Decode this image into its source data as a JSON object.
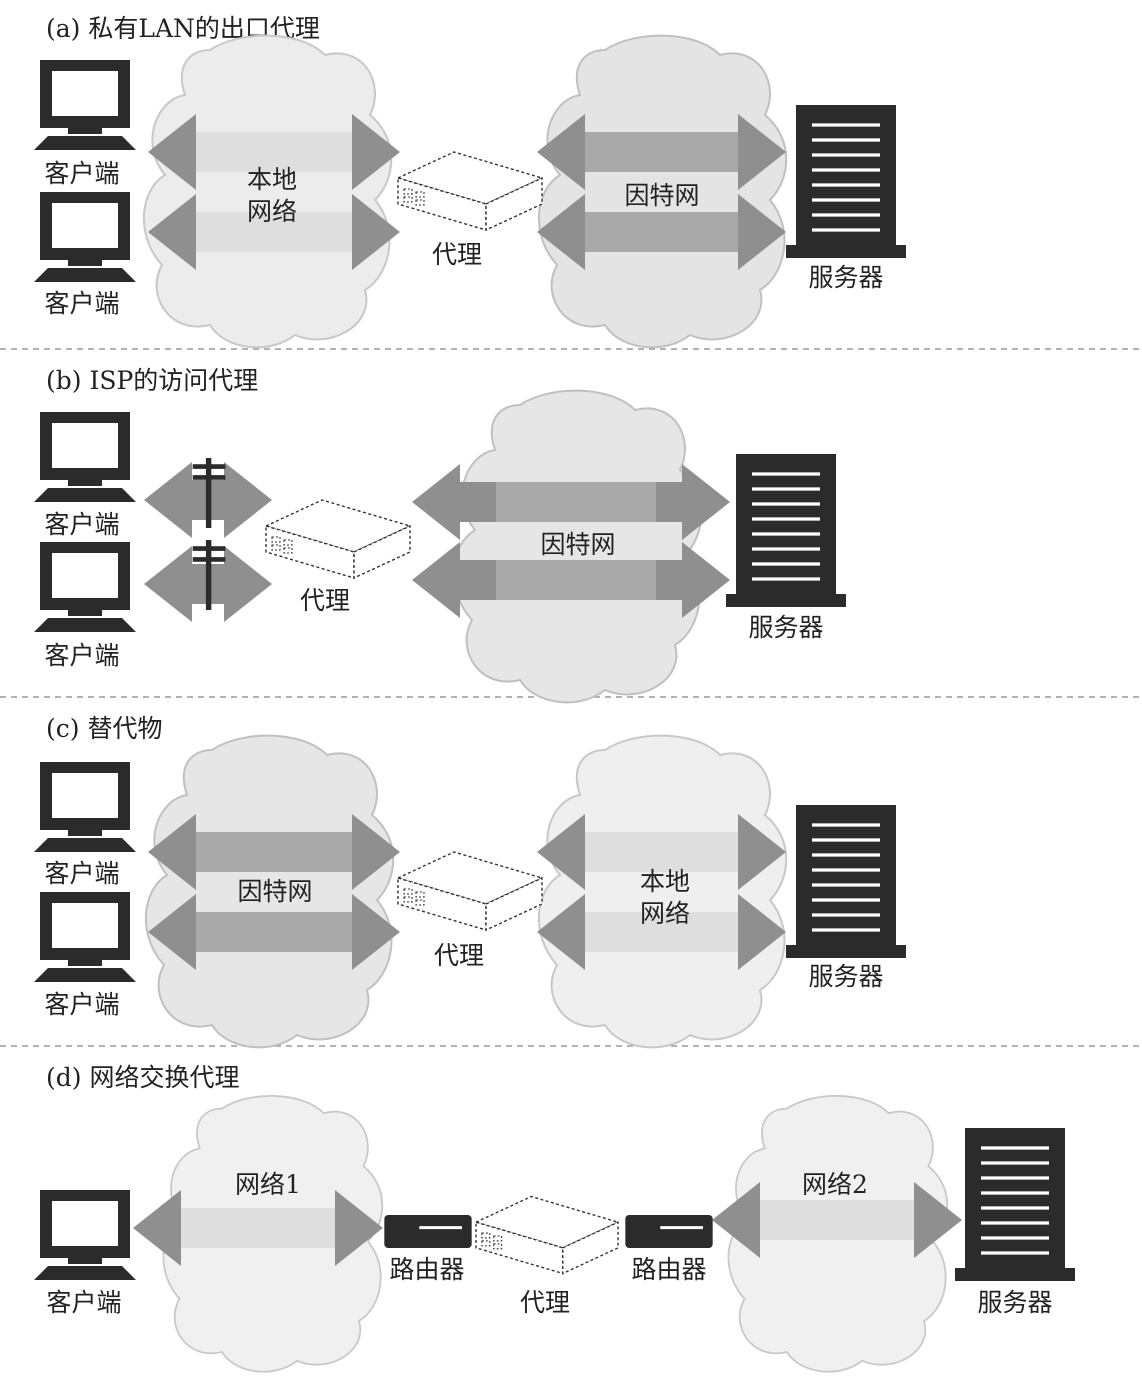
{
  "panels": [
    {
      "title": "(a) 私有LAN的出口代理",
      "client_label": "客户端",
      "client2_label": "客户端",
      "left_cloud_label": [
        "本地",
        "网络"
      ],
      "proxy_label": "代理",
      "right_cloud_label": [
        "因特网"
      ],
      "server_label": "服务器"
    },
    {
      "title": "(b) ISP的访问代理",
      "client_label": "客户端",
      "client2_label": "客户端",
      "proxy_label": "代理",
      "right_cloud_label": [
        "因特网"
      ],
      "server_label": "服务器"
    },
    {
      "title": "(c) 替代物",
      "client_label": "客户端",
      "client2_label": "客户端",
      "left_cloud_label": [
        "因特网"
      ],
      "proxy_label": "代理",
      "right_cloud_label": [
        "本地",
        "网络"
      ],
      "server_label": "服务器"
    },
    {
      "title": "(d) 网络交换代理",
      "client_label": "客户端",
      "left_cloud_label": [
        "网络1"
      ],
      "router1_label": "路由器",
      "proxy_label": "代理",
      "router2_label": "路由器",
      "right_cloud_label": [
        "网络2"
      ],
      "server_label": "服务器"
    }
  ],
  "colors": {
    "arrow": "#8f8f8f",
    "cloud_fill": "#ececec",
    "cloud_stroke": "#c8c8c8",
    "device": "#2b2b2b",
    "band_dark": "#a7a7a7",
    "band_light": "#dcdcdc"
  }
}
